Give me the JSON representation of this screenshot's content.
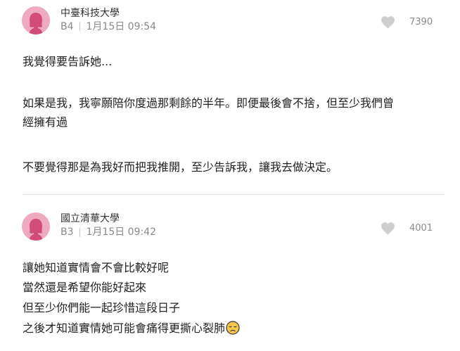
{
  "comments": [
    {
      "school": "中臺科技大學",
      "floor": "B4",
      "time": "1月15日 09:54",
      "likes": "7390",
      "avatar_icon": "female-avatar-icon",
      "lines": [
        "我覺得要告訴她...",
        "如果是我，我寧願陪你度過那剩餘的半年。即便最後會不捨，但至少我們曾",
        "經擁有過",
        "不要覺得那是為我好而把我推開，至少告訴我，讓我去做決定。"
      ]
    },
    {
      "school": "國立清華大學",
      "floor": "B3",
      "time": "1月15日 09:42",
      "likes": "4001",
      "avatar_icon": "female-avatar-icon",
      "lines": [
        "讓她知道實情會不會比較好呢",
        "當然還是希望你能好起來",
        "但至少你們能一起珍惜這段日子",
        "之後才知道實情她可能會痛得更撕心裂肺"
      ],
      "emoji": "disappointed-face-emoji"
    }
  ],
  "colors": {
    "avatar_bg": "#f0aabf",
    "avatar_fg": "#d24c7a",
    "heart": "#cfcfcf",
    "meta_text": "#8a8a8a",
    "divider": "#e8e8e8"
  }
}
